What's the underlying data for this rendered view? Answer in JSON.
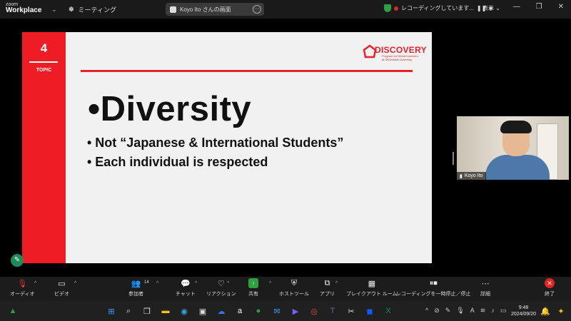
{
  "topbar": {
    "brand_line1": "zoom",
    "brand_line2": "Workplace",
    "meeting_label": "ミーティング",
    "share_title": "Koyo Ito さんの画面",
    "more_glyph": "···",
    "recording_label": "レコーディングしています...",
    "view_label": "表示"
  },
  "slide": {
    "topic_number": "4",
    "topic_label": "TOPIC",
    "logo_title": "DISCOVERY",
    "logo_sub1": "Program for Global Learners",
    "logo_sub2": "at OKAYAMA University",
    "heading": "•Diversity",
    "bullets": [
      "• Not “Japanese & International Students”",
      "• Each individual is respected"
    ]
  },
  "video": {
    "name": "Koyo Ito"
  },
  "toolbar": {
    "audio_label": "オーディオ",
    "video_label": "ビデオ",
    "participants_label": "参加者",
    "participants_count": "14",
    "chat_label": "チャット",
    "reaction_label": "リアクション",
    "share_label": "共有",
    "host_tools_label": "ホストツール",
    "apps_label": "アプリ",
    "breakout_label": "ブレイクアウト ルーム",
    "recording_ctrl_label": "レコーディングを一時停止／停止",
    "details_label": "詳細",
    "end_label": "終了"
  },
  "taskbar": {
    "ime_label": "A",
    "time": "9:48",
    "date": "2024/09/20"
  },
  "colors": {
    "accent_red": "#ee1c25",
    "share_green": "#2ea043",
    "zoom_blue": "#0b5cff"
  }
}
